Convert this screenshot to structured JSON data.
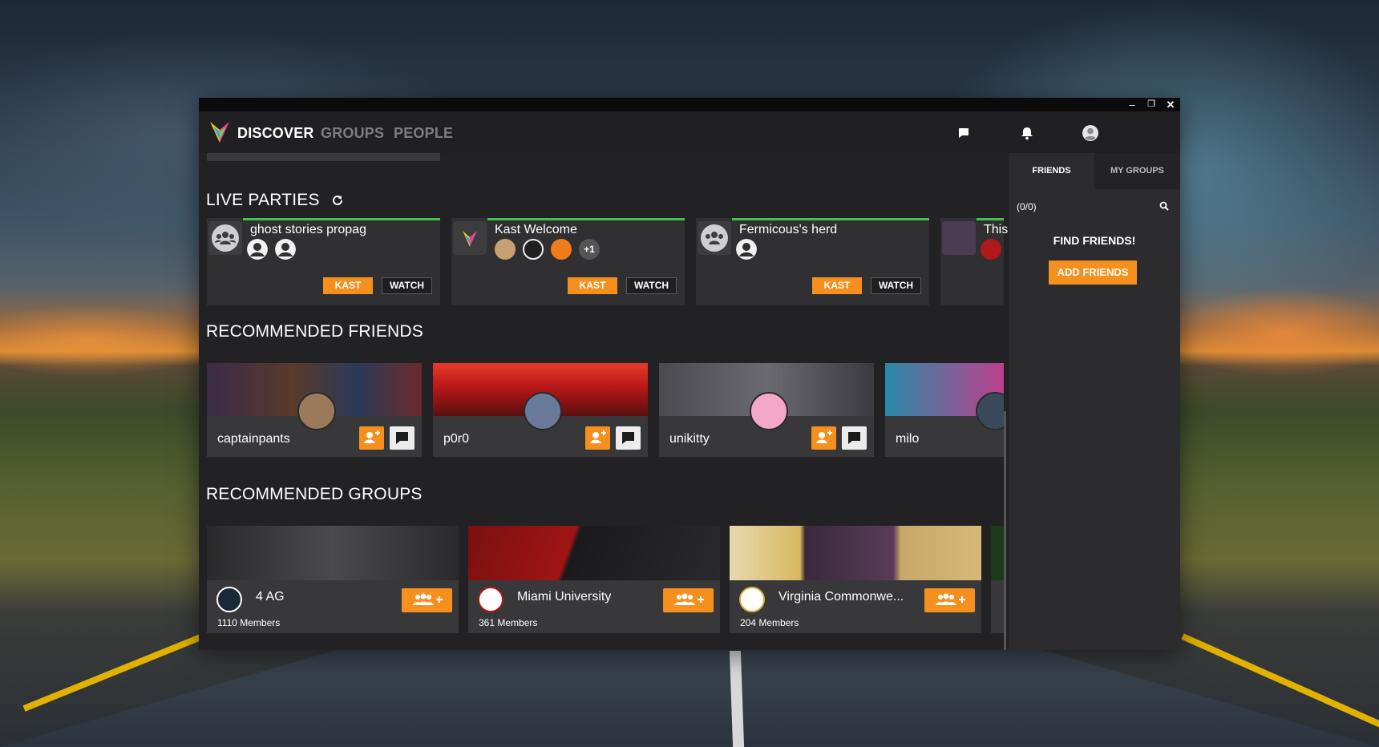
{
  "window": {
    "controls": {
      "minimize": "–",
      "restore": "❐",
      "close": "✕"
    }
  },
  "nav": {
    "tabs": [
      {
        "label": "DISCOVER",
        "active": true
      },
      {
        "label": "GROUPS",
        "active": false
      },
      {
        "label": "PEOPLE",
        "active": false
      }
    ],
    "icons": [
      "chat-icon",
      "bell-icon",
      "user-avatar-icon"
    ]
  },
  "sections": {
    "live_parties": "LIVE PARTIES",
    "recommended_friends": "RECOMMENDED FRIENDS",
    "recommended_groups": "RECOMMENDED GROUPS"
  },
  "parties": [
    {
      "name": "ghost stories propag",
      "kast": "KAST",
      "watch": "WATCH"
    },
    {
      "name": "Kast Welcome",
      "extra": "+1",
      "kast": "KAST",
      "watch": "WATCH"
    },
    {
      "name": "Fermicous's herd",
      "kast": "KAST",
      "watch": "WATCH"
    },
    {
      "name": "This"
    }
  ],
  "friends": [
    {
      "name": "captainpants"
    },
    {
      "name": "p0r0"
    },
    {
      "name": "unikitty"
    },
    {
      "name": "milo"
    }
  ],
  "groups": [
    {
      "name": "4 AG",
      "members": "1110 Members"
    },
    {
      "name": "Miami University",
      "members": "361 Members"
    },
    {
      "name": "Virginia Commonwe...",
      "members": "204 Members"
    }
  ],
  "sidepanel": {
    "tabs": {
      "friends": "FRIENDS",
      "my_groups": "MY GROUPS"
    },
    "count": "(0/0)",
    "find_title": "FIND FRIENDS!",
    "add_friends": "ADD FRIENDS"
  },
  "colors": {
    "accent": "#f5901e",
    "live_indicator": "#46c24a",
    "window_bg": "#222224",
    "card_bg": "#303033"
  }
}
